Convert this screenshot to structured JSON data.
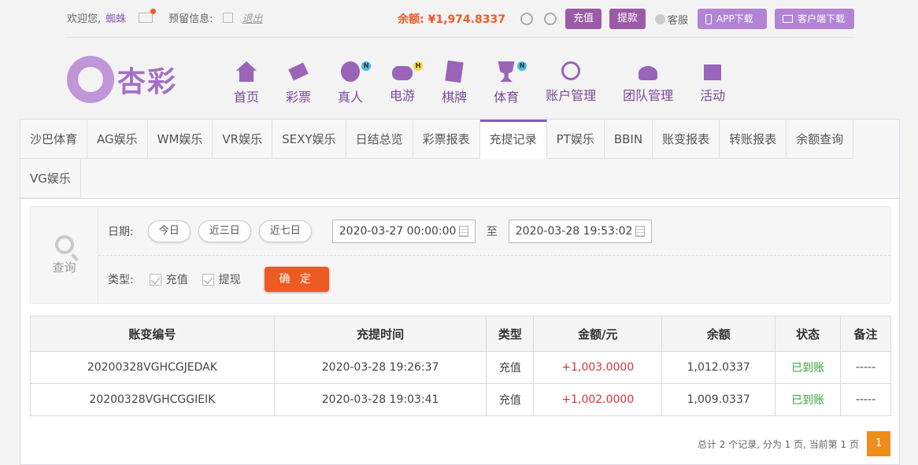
{
  "topbar": {
    "welcome": "欢迎您,",
    "username": "蜘蛛",
    "reserved_info": "预留信息:",
    "logout": "退出",
    "balance_label": "余额:",
    "balance_value": "¥1,974.8337",
    "recharge": "充值",
    "withdraw": "提款",
    "service": "客服",
    "app_download": "APP下载",
    "client_download": "客户端下载"
  },
  "logo": {
    "text": "杏彩"
  },
  "nav": [
    {
      "label": "首页",
      "icon": "house-icon"
    },
    {
      "label": "彩票",
      "icon": "ticket-icon"
    },
    {
      "label": "真人",
      "icon": "live-icon",
      "badge": "N"
    },
    {
      "label": "电游",
      "icon": "gamepad-icon",
      "badge": "H"
    },
    {
      "label": "棋牌",
      "icon": "cards-icon"
    },
    {
      "label": "体育",
      "icon": "trophy-icon",
      "badge": "N"
    },
    {
      "label": "账户管理",
      "icon": "coin-icon"
    },
    {
      "label": "团队管理",
      "icon": "team-icon"
    },
    {
      "label": "活动",
      "icon": "gift-icon"
    }
  ],
  "subtabs": [
    "沙巴体育",
    "AG娱乐",
    "WM娱乐",
    "VR娱乐",
    "SEXY娱乐",
    "日结总览",
    "彩票报表",
    "充提记录",
    "PT娱乐",
    "BBIN",
    "账变报表",
    "转账报表",
    "余额查询",
    "VG娱乐"
  ],
  "active_subtab": "充提记录",
  "filter": {
    "query_label": "查询",
    "date_label": "日期:",
    "today": "今日",
    "three_days": "近三日",
    "seven_days": "近七日",
    "date_from": "2020-03-27 00:00:00",
    "to": "至",
    "date_to": "2020-03-28 19:53:02",
    "type_label": "类型:",
    "type_recharge": "充值",
    "type_withdraw": "提现",
    "confirm": "确 定"
  },
  "table": {
    "headers": [
      "账变编号",
      "充提时间",
      "类型",
      "金额/元",
      "余额",
      "状态",
      "备注"
    ],
    "rows": [
      [
        "20200328VGHCGJEDAK",
        "2020-03-28 19:26:37",
        "充值",
        "+1,003.0000",
        "1,012.0337",
        "已到账",
        "-----"
      ],
      [
        "20200328VGHCGGIEIK",
        "2020-03-28 19:03:41",
        "充值",
        "+1,002.0000",
        "1,009.0337",
        "已到账",
        "-----"
      ]
    ]
  },
  "pager": {
    "summary": "总计 2 个记录, 分为 1 页, 当前第 1 页",
    "page": "1"
  },
  "colors": {
    "accent": "#9b5ba8",
    "orange": "#ef5a22",
    "amount": "#d9343b",
    "status": "#3aa33a"
  }
}
